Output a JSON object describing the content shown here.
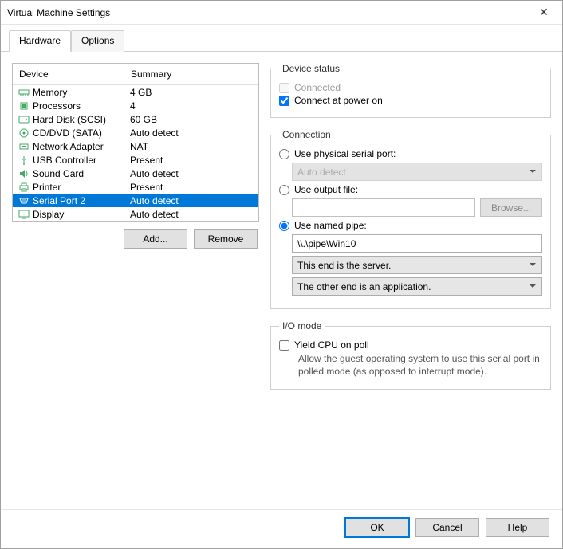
{
  "window": {
    "title": "Virtual Machine Settings"
  },
  "tabs": {
    "hardware": "Hardware",
    "options": "Options"
  },
  "columns": {
    "device": "Device",
    "summary": "Summary"
  },
  "devices": [
    {
      "name": "Memory",
      "summary": "4 GB",
      "icon": "memory"
    },
    {
      "name": "Processors",
      "summary": "4",
      "icon": "cpu"
    },
    {
      "name": "Hard Disk (SCSI)",
      "summary": "60 GB",
      "icon": "hdd"
    },
    {
      "name": "CD/DVD (SATA)",
      "summary": "Auto detect",
      "icon": "cd"
    },
    {
      "name": "Network Adapter",
      "summary": "NAT",
      "icon": "net"
    },
    {
      "name": "USB Controller",
      "summary": "Present",
      "icon": "usb"
    },
    {
      "name": "Sound Card",
      "summary": "Auto detect",
      "icon": "sound"
    },
    {
      "name": "Printer",
      "summary": "Present",
      "icon": "printer"
    },
    {
      "name": "Serial Port 2",
      "summary": "Auto detect",
      "icon": "serial",
      "selected": true
    },
    {
      "name": "Display",
      "summary": "Auto detect",
      "icon": "display"
    }
  ],
  "buttons": {
    "add": "Add...",
    "remove": "Remove",
    "ok": "OK",
    "cancel": "Cancel",
    "help": "Help",
    "browse": "Browse..."
  },
  "status": {
    "legend": "Device status",
    "connected": "Connected",
    "connect_power_on": "Connect at power on"
  },
  "connection": {
    "legend": "Connection",
    "use_physical": "Use physical serial port:",
    "physical_value": "Auto detect",
    "use_output": "Use output file:",
    "output_value": "",
    "use_named_pipe": "Use named pipe:",
    "pipe_value": "\\\\.\\pipe\\Win10",
    "end1": "This end is the server.",
    "end2": "The other end is an application."
  },
  "io": {
    "legend": "I/O mode",
    "yield": "Yield CPU on poll",
    "hint": "Allow the guest operating system to use this serial port in polled mode (as opposed to interrupt mode)."
  }
}
